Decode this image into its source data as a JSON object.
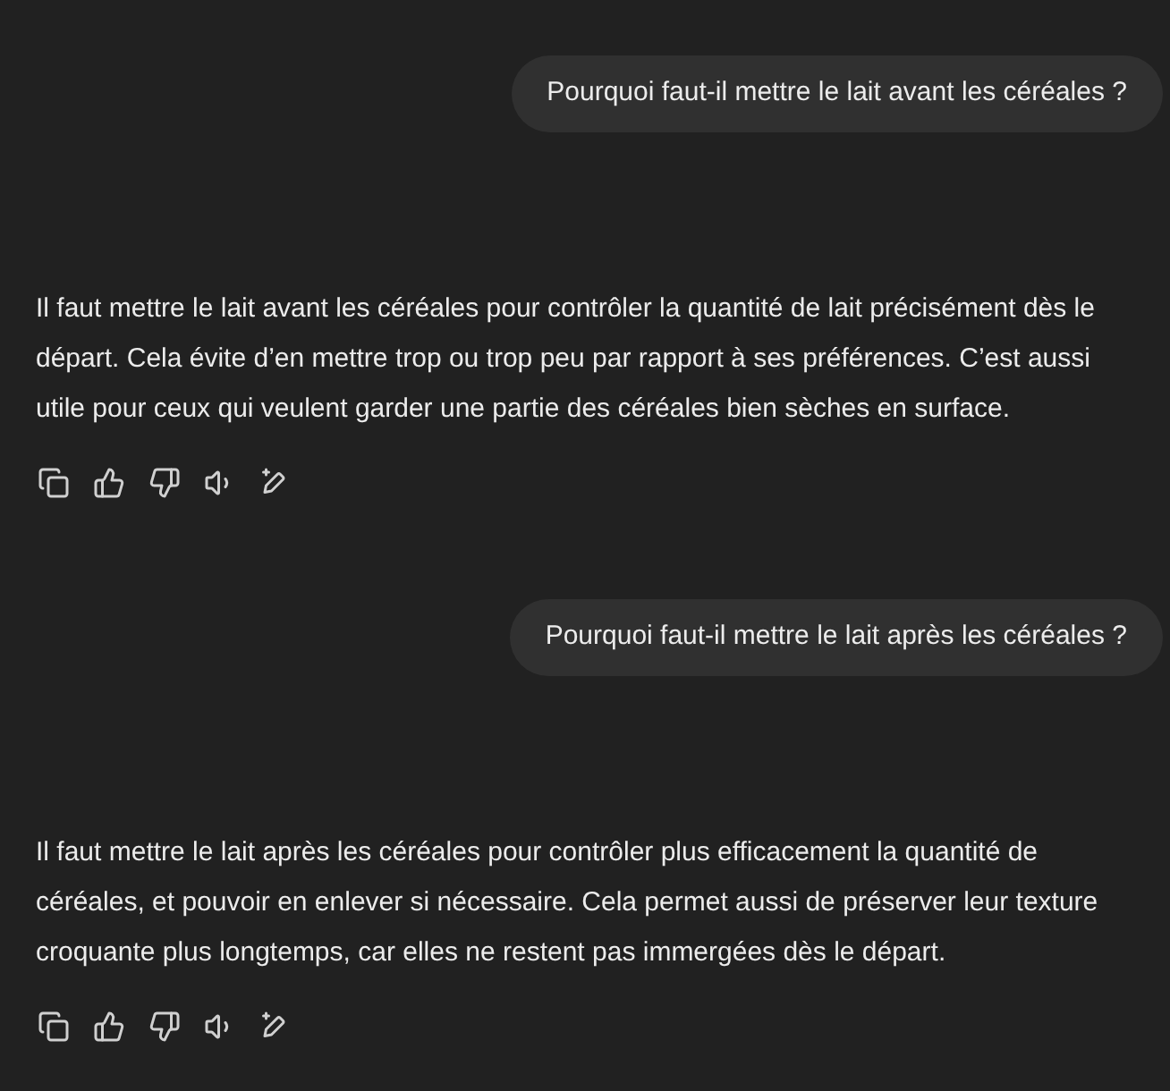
{
  "messages": [
    {
      "question": "Pourquoi faut-il mettre le lait avant les céréales ?",
      "answer": "Il faut mettre le lait avant les céréales pour contrôler la quantité de lait précisément dès le départ. Cela évite d’en mettre trop ou trop peu par rapport à ses préférences. C’est aussi utile pour ceux qui veulent garder une partie des céréales bien sèches en surface."
    },
    {
      "question": "Pourquoi faut-il mettre le lait après les céréales ?",
      "answer": "Il faut mettre le lait après les céréales pour contrôler plus efficacement la quantité de céréales, et pouvoir en enlever si nécessaire. Cela permet aussi de préserver leur texture croquante plus longtemps, car elles ne restent pas immergées dès le départ."
    }
  ]
}
